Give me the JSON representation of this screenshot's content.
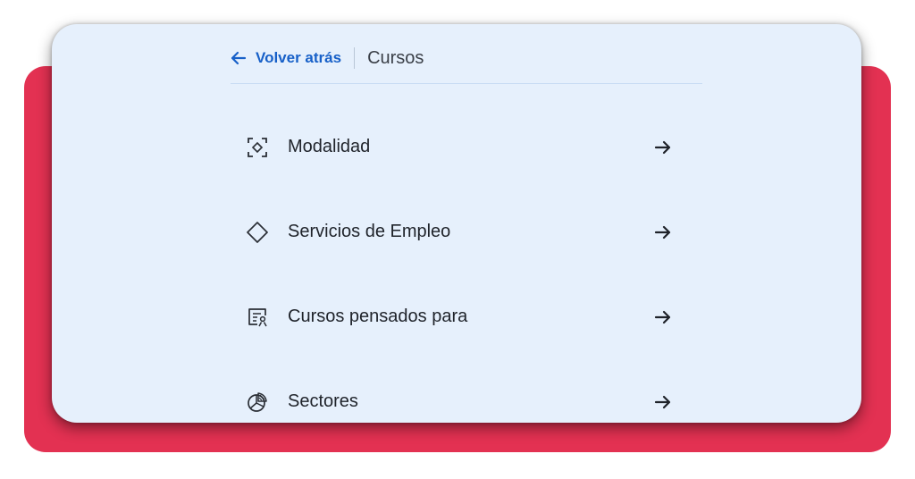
{
  "header": {
    "back_label": "Volver atrás",
    "current_section": "Cursos"
  },
  "menu": {
    "items": [
      {
        "label": "Modalidad",
        "icon": "modality-icon"
      },
      {
        "label": "Servicios de Empleo",
        "icon": "diamond-icon"
      },
      {
        "label": "Cursos pensados para",
        "icon": "audience-card-icon"
      },
      {
        "label": "Sectores",
        "icon": "pie-chart-icon"
      }
    ]
  },
  "colors": {
    "accent": "#1760c8",
    "card_bg": "#e6f0fc",
    "backdrop": "#e33152",
    "text": "#1f232a"
  }
}
